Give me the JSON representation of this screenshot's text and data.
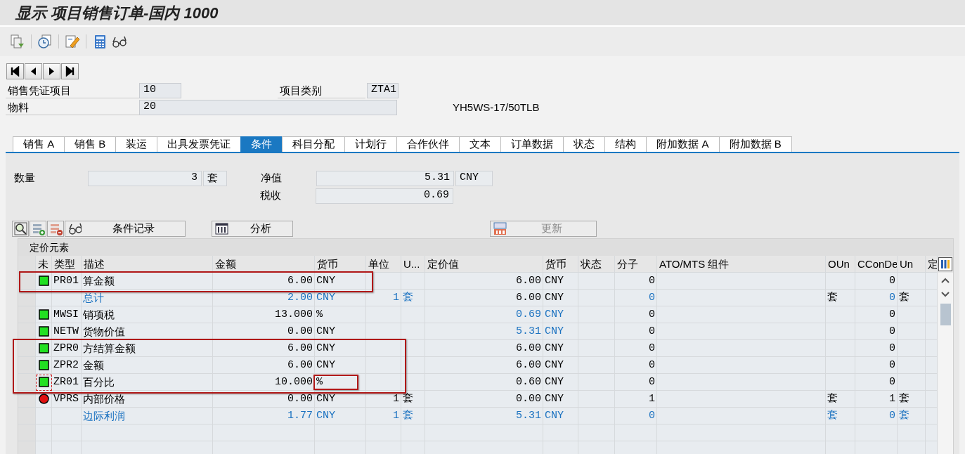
{
  "window": {
    "title": "显示 项目销售订单-国内 1000"
  },
  "header": {
    "item_label": "销售凭证项目",
    "item_value": "10",
    "category_label": "项目类别",
    "category_value": "ZTA1",
    "material_label": "物料",
    "material_value": "20",
    "material_text": "YH5WS-17/50TLB"
  },
  "tabs": [
    {
      "label": "销售 A",
      "selected": false
    },
    {
      "label": "销售 B",
      "selected": false
    },
    {
      "label": "装运",
      "selected": false
    },
    {
      "label": "出具发票凭证",
      "selected": false
    },
    {
      "label": "条件",
      "selected": true
    },
    {
      "label": "科目分配",
      "selected": false
    },
    {
      "label": "计划行",
      "selected": false
    },
    {
      "label": "合作伙伴",
      "selected": false
    },
    {
      "label": "文本",
      "selected": false
    },
    {
      "label": "订单数据",
      "selected": false
    },
    {
      "label": "状态",
      "selected": false
    },
    {
      "label": "结构",
      "selected": false
    },
    {
      "label": "附加数据 A",
      "selected": false
    },
    {
      "label": "附加数据 B",
      "selected": false
    }
  ],
  "totals": {
    "quantity_label": "数量",
    "quantity": "3",
    "quantity_unit": "套",
    "net_label": "净值",
    "net_value": "5.31",
    "net_currency": "CNY",
    "tax_label": "税收",
    "tax_value": "0.69"
  },
  "buttons": [
    {
      "label": "条件记录",
      "kind": "records",
      "disabled": false
    },
    {
      "label": "分析",
      "kind": "analysis",
      "disabled": false
    },
    {
      "label": "更新",
      "kind": "update",
      "disabled": true
    }
  ],
  "conditions": {
    "title": "定价元素",
    "columns": [
      "未",
      "类型",
      "描述",
      "金额",
      "货币",
      "单位",
      "U...",
      "定价值",
      "货币",
      "状态",
      "分子",
      "ATO/MTS 组件",
      "OUn",
      "CConDe",
      "Un",
      "定"
    ],
    "rows": [
      {
        "color": "#22e022",
        "framed": true,
        "unit_framed": false,
        "focused": false,
        "cells": [
          null,
          {
            "text": "PR01",
            "blue": false
          },
          {
            "text": "算金额",
            "blue": false
          },
          {
            "text": "6.00",
            "blue": false
          },
          {
            "text": "CNY",
            "blue": false
          },
          null,
          null,
          {
            "text": "6.00",
            "blue": false
          },
          {
            "text": "CNY",
            "blue": false
          },
          null,
          {
            "text": "0",
            "blue": false
          },
          null,
          null,
          {
            "text": "0",
            "blue": false
          },
          null,
          null
        ]
      },
      {
        "framed": false,
        "unit_framed": false,
        "focused": false,
        "cells": [
          null,
          null,
          {
            "text": "总计",
            "blue": true
          },
          {
            "text": "2.00",
            "blue": true
          },
          {
            "text": "CNY",
            "blue": true
          },
          {
            "text": "1",
            "blue": true
          },
          {
            "text": "套",
            "blue": true
          },
          {
            "text": "6.00",
            "blue": false
          },
          {
            "text": "CNY",
            "blue": false
          },
          null,
          {
            "text": "0",
            "blue": true
          },
          null,
          {
            "text": "套",
            "blue": false
          },
          {
            "text": "0",
            "blue": true
          },
          {
            "text": "套",
            "blue": false
          },
          null
        ]
      },
      {
        "color": "#22e022",
        "framed": false,
        "unit_framed": false,
        "focused": false,
        "cells": [
          null,
          {
            "text": "MWSI",
            "blue": false
          },
          {
            "text": "销项税",
            "blue": false
          },
          {
            "text": "13.000",
            "blue": false
          },
          {
            "text": "%",
            "blue": false
          },
          null,
          null,
          {
            "text": "0.69",
            "blue": true
          },
          {
            "text": "CNY",
            "blue": true
          },
          null,
          {
            "text": "0",
            "blue": false
          },
          null,
          null,
          {
            "text": "0",
            "blue": false
          },
          null,
          null
        ]
      },
      {
        "color": "#22e022",
        "framed": false,
        "unit_framed": false,
        "focused": false,
        "cells": [
          null,
          {
            "text": "NETW",
            "blue": false
          },
          {
            "text": "货物价值",
            "blue": false
          },
          {
            "text": "0.00",
            "blue": false
          },
          {
            "text": "CNY",
            "blue": false
          },
          null,
          null,
          {
            "text": "5.31",
            "blue": true
          },
          {
            "text": "CNY",
            "blue": true
          },
          null,
          {
            "text": "0",
            "blue": false
          },
          null,
          null,
          {
            "text": "0",
            "blue": false
          },
          null,
          null
        ]
      },
      {
        "color": "#22e022",
        "framed": true,
        "unit_framed": false,
        "focused": false,
        "cells": [
          null,
          {
            "text": "ZPR0",
            "blue": false
          },
          {
            "text": "方结算金额",
            "blue": false
          },
          {
            "text": "6.00",
            "blue": false
          },
          {
            "text": "CNY",
            "blue": false
          },
          null,
          null,
          {
            "text": "6.00",
            "blue": false
          },
          {
            "text": "CNY",
            "blue": false
          },
          null,
          {
            "text": "0",
            "blue": false
          },
          null,
          null,
          {
            "text": "0",
            "blue": false
          },
          null,
          null
        ]
      },
      {
        "color": "#22e022",
        "framed": true,
        "unit_framed": false,
        "focused": false,
        "cells": [
          null,
          {
            "text": "ZPR2",
            "blue": false
          },
          {
            "text": "金额",
            "blue": false
          },
          {
            "text": "6.00",
            "blue": false
          },
          {
            "text": "CNY",
            "blue": false
          },
          null,
          null,
          {
            "text": "6.00",
            "blue": false
          },
          {
            "text": "CNY",
            "blue": false
          },
          null,
          {
            "text": "0",
            "blue": false
          },
          null,
          null,
          {
            "text": "0",
            "blue": false
          },
          null,
          null
        ]
      },
      {
        "color": "#22e022",
        "framed": true,
        "unit_framed": true,
        "focused": true,
        "cells": [
          null,
          {
            "text": "ZR01",
            "blue": false
          },
          {
            "text": "百分比",
            "blue": false
          },
          {
            "text": "10.000",
            "blue": false
          },
          {
            "text": "%",
            "blue": false
          },
          null,
          null,
          {
            "text": "0.60",
            "blue": false
          },
          {
            "text": "CNY",
            "blue": false
          },
          null,
          {
            "text": "0",
            "blue": false
          },
          null,
          null,
          {
            "text": "0",
            "blue": false
          },
          null,
          null
        ]
      },
      {
        "color": "#e01010",
        "framed": false,
        "unit_framed": false,
        "focused": false,
        "cells": [
          null,
          {
            "text": "VPRS",
            "blue": false
          },
          {
            "text": "内部价格",
            "blue": false
          },
          {
            "text": "0.00",
            "blue": false
          },
          {
            "text": "CNY",
            "blue": false
          },
          {
            "text": "1",
            "blue": false
          },
          {
            "text": "套",
            "blue": false
          },
          {
            "text": "0.00",
            "blue": false
          },
          {
            "text": "CNY",
            "blue": false
          },
          null,
          {
            "text": "1",
            "blue": false
          },
          null,
          {
            "text": "套",
            "blue": false
          },
          {
            "text": "1",
            "blue": false
          },
          {
            "text": "套",
            "blue": false
          },
          null
        ]
      },
      {
        "framed": false,
        "unit_framed": false,
        "focused": false,
        "cells": [
          null,
          null,
          {
            "text": "边际利润",
            "blue": true
          },
          {
            "text": "1.77",
            "blue": true
          },
          {
            "text": "CNY",
            "blue": true
          },
          {
            "text": "1",
            "blue": true
          },
          {
            "text": "套",
            "blue": true
          },
          {
            "text": "5.31",
            "blue": true
          },
          {
            "text": "CNY",
            "blue": true
          },
          null,
          {
            "text": "0",
            "blue": true
          },
          null,
          {
            "text": "套",
            "blue": true
          },
          {
            "text": "0",
            "blue": true
          },
          {
            "text": "套",
            "blue": true
          },
          null
        ]
      }
    ]
  }
}
